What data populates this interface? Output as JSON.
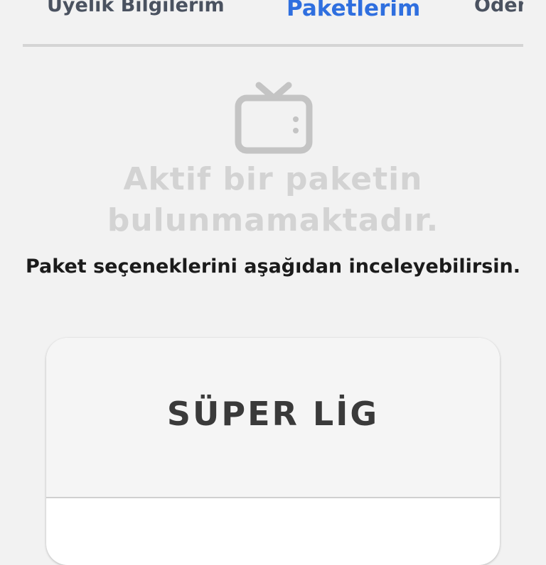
{
  "tabs": [
    {
      "label": "Üyelik Bilgilerim",
      "active": false
    },
    {
      "label": "Paketlerim",
      "active": true
    },
    {
      "label": "Ödeme",
      "active": false
    }
  ],
  "empty_state": {
    "icon": "tv-icon",
    "title": "Aktif bir paketin bulunmamaktadır.",
    "subtitle": "Paket seçeneklerini aşağıdan inceleyebilirsin."
  },
  "package_card": {
    "name": "SÜPER LİG"
  },
  "colors": {
    "active_tab": "#2f6fdf",
    "inactive_tab": "#4a5260",
    "empty_title": "#d3d3d3",
    "background": "#f2f2f2"
  }
}
